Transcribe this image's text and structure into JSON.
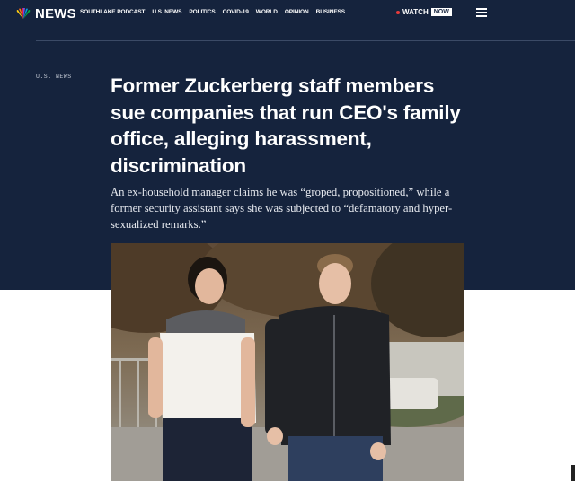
{
  "brand": {
    "name": "NEWS",
    "logo_icon": "nbc-peacock-icon"
  },
  "nav": {
    "items": [
      "SOUTHLAKE PODCAST",
      "U.S. NEWS",
      "POLITICS",
      "COVID-19",
      "WORLD",
      "OPINION",
      "BUSINESS"
    ],
    "watch_label": "WATCH",
    "watch_now_label": "NOW",
    "menu_icon": "hamburger-menu-icon"
  },
  "article": {
    "section": "U.S. NEWS",
    "headline": "Former Zuckerberg staff members sue companies that run CEO's family office, alleging harassment, discrimination",
    "dek": "An ex-household manager claims he was “groped, propositioned,” while a former security assistant says she was subjected to “defamatory and hyper-sexualized remarks.”"
  },
  "colors": {
    "hero_bg": "#15233d",
    "live_red": "#e83a3a",
    "text_white": "#ffffff"
  }
}
